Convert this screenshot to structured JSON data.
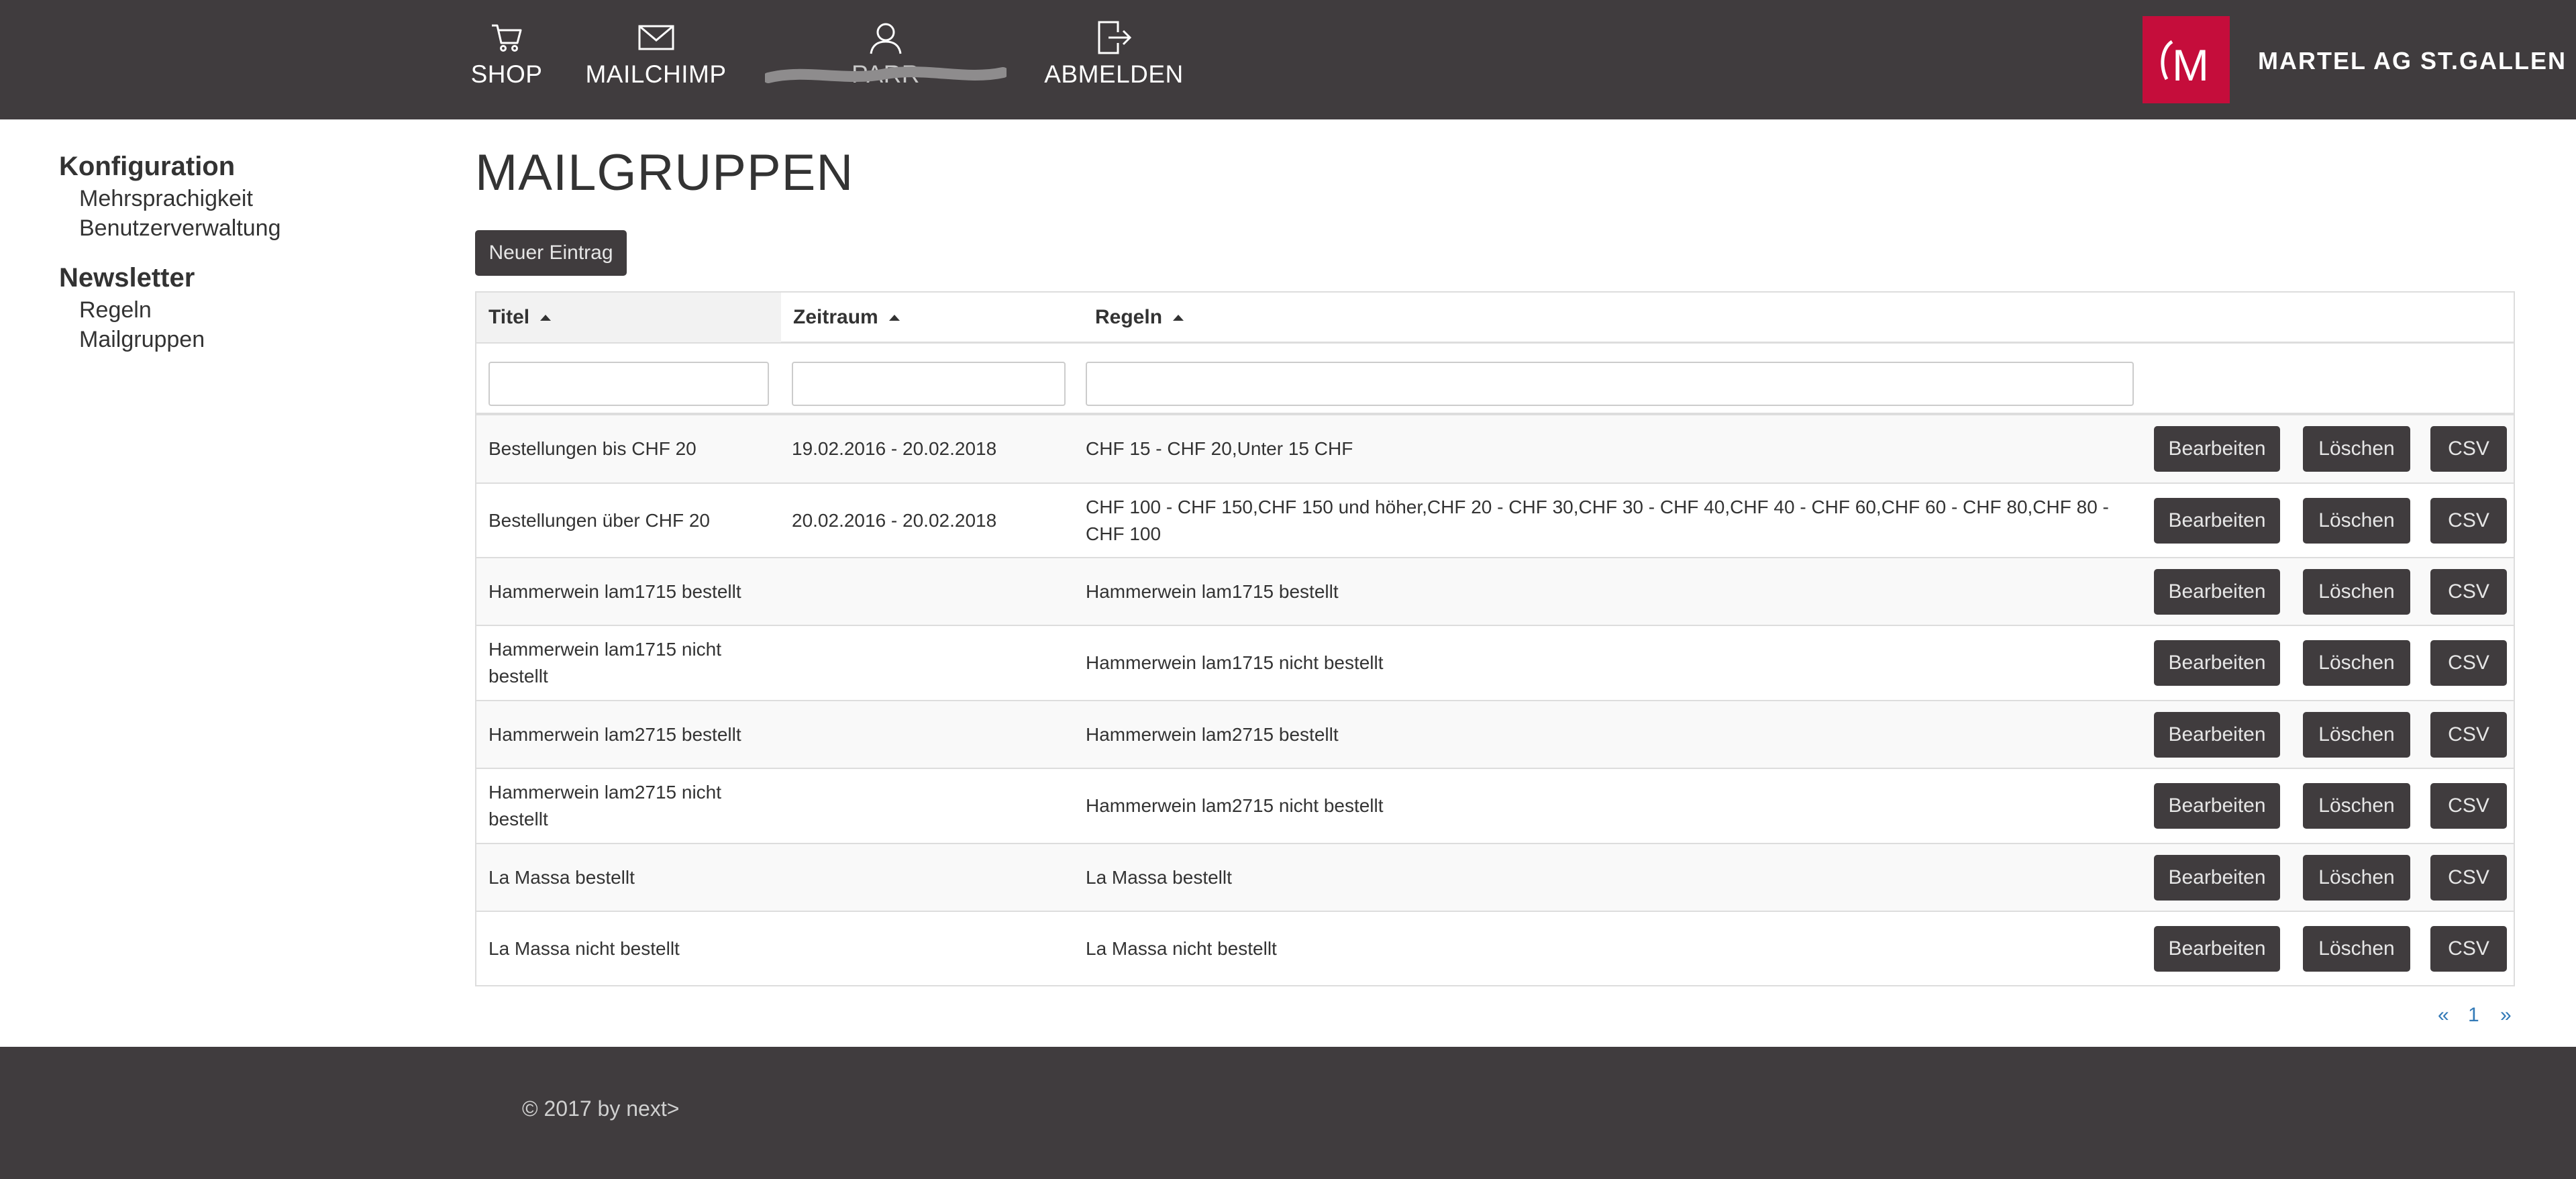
{
  "header": {
    "nav": [
      {
        "label": "SHOP",
        "icon": "cart-icon"
      },
      {
        "label": "MAILCHIMP",
        "icon": "envelope-icon"
      },
      {
        "label": "PARR",
        "icon": "user-icon"
      },
      {
        "label": "ABMELDEN",
        "icon": "logout-icon"
      }
    ],
    "brand": {
      "name": "MARTEL AG ST.GALLEN",
      "logo_letter": "M",
      "logo_color": "#c50d3b"
    }
  },
  "sidebar": {
    "groups": [
      {
        "heading": "Konfiguration",
        "links": [
          "Mehrsprachigkeit",
          "Benutzerverwaltung"
        ]
      },
      {
        "heading": "Newsletter",
        "links": [
          "Regeln",
          "Mailgruppen"
        ]
      }
    ]
  },
  "main": {
    "title": "MAILGRUPPEN",
    "new_entry_label": "Neuer Eintrag",
    "table": {
      "columns": [
        "Titel",
        "Zeitraum",
        "Regeln"
      ],
      "actions": {
        "edit": "Bearbeiten",
        "delete": "Löschen",
        "csv": "CSV"
      },
      "rows": [
        {
          "title": "Bestellungen bis CHF 20",
          "range": "19.02.2016 - 20.02.2018",
          "rules": "CHF 15 - CHF 20,Unter 15 CHF"
        },
        {
          "title": "Bestellungen über CHF 20",
          "range": "20.02.2016 - 20.02.2018",
          "rules": "CHF 100 - CHF 150,CHF 150 und höher,CHF 20 - CHF 30,CHF 30 - CHF 40,CHF 40 - CHF 60,CHF 60 - CHF 80,CHF 80 - CHF 100"
        },
        {
          "title": "Hammerwein lam1715 bestellt",
          "range": "",
          "rules": "Hammerwein lam1715 bestellt"
        },
        {
          "title": "Hammerwein lam1715 nicht bestellt",
          "range": "",
          "rules": "Hammerwein lam1715 nicht bestellt"
        },
        {
          "title": "Hammerwein lam2715 bestellt",
          "range": "",
          "rules": "Hammerwein lam2715 bestellt"
        },
        {
          "title": "Hammerwein lam2715 nicht bestellt",
          "range": "",
          "rules": "Hammerwein lam2715 nicht bestellt"
        },
        {
          "title": "La Massa bestellt",
          "range": "",
          "rules": "La Massa bestellt"
        },
        {
          "title": "La Massa nicht bestellt",
          "range": "",
          "rules": "La Massa nicht bestellt"
        }
      ]
    },
    "pagination": {
      "prev": "«",
      "page": "1",
      "next": "»"
    }
  },
  "footer": {
    "copyright": "© 2017 by next>"
  },
  "colors": {
    "header_bg": "#403c3e",
    "button_bg": "#403c3e",
    "link": "#337ab7"
  }
}
